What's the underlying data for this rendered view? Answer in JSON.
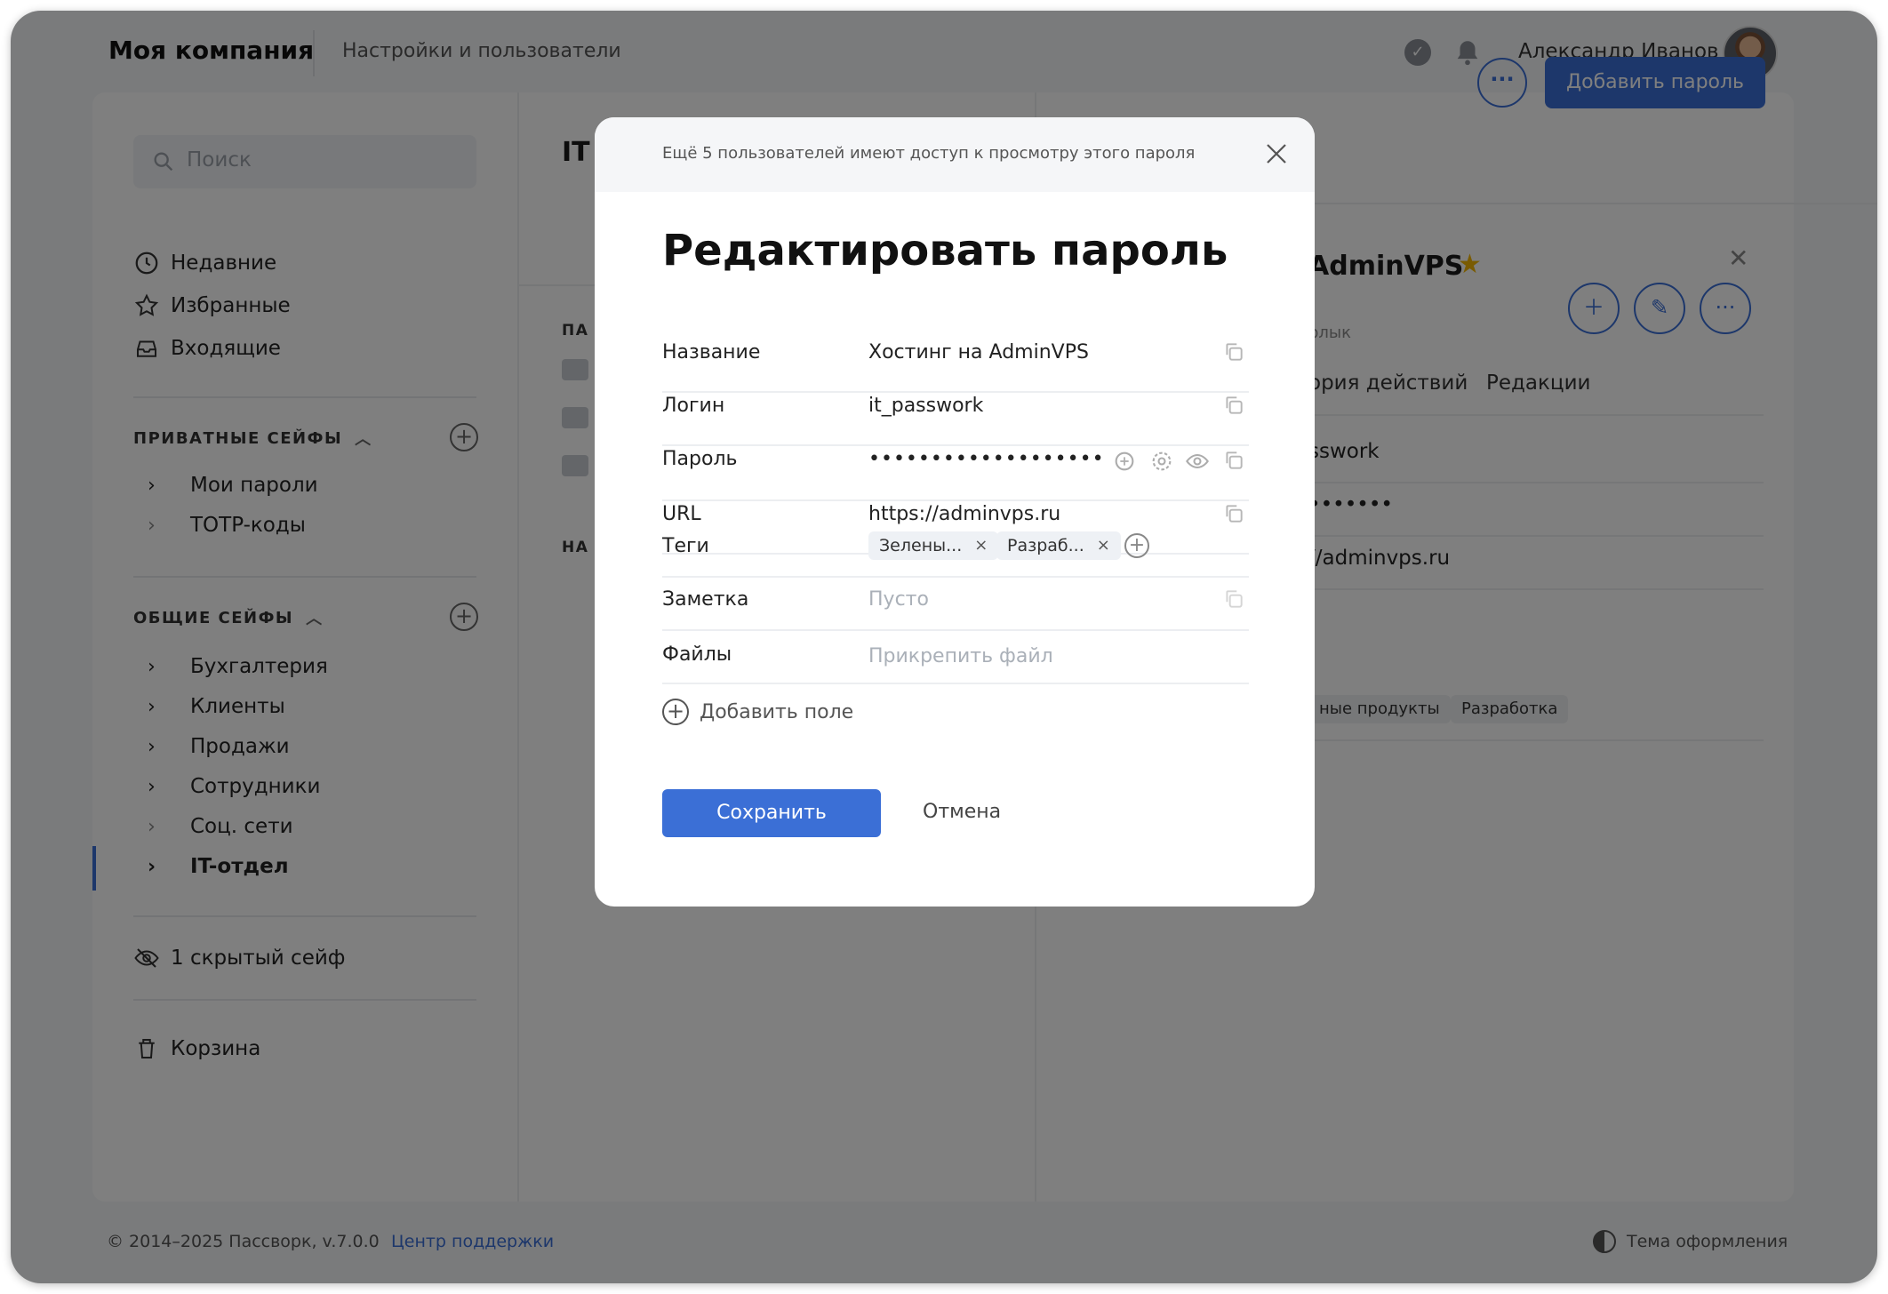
{
  "header": {
    "brand": "Моя компания",
    "subtitle": "Настройки и пользователи",
    "user_name": "Александр Иванов"
  },
  "sidebar": {
    "search_placeholder": "Поиск",
    "quick": [
      {
        "label": "Недавние",
        "icon": "clock-icon"
      },
      {
        "label": "Избранные",
        "icon": "star-icon"
      },
      {
        "label": "Входящие",
        "icon": "inbox-icon"
      }
    ],
    "private_title": "ПРИВАТНЫЕ СЕЙФЫ",
    "private_vaults": [
      "Мои пароли",
      "TOTP-коды"
    ],
    "shared_title": "ОБЩИЕ СЕЙФЫ",
    "shared_vaults": [
      "Бухгалтерия",
      "Клиенты",
      "Продажи",
      "Сотрудники",
      "Соц. сети",
      "IT-отдел"
    ],
    "hidden": "1 скрытый сейф",
    "trash": "Корзина"
  },
  "middle": {
    "title": "IT",
    "label1": "ПА",
    "label2": "НА"
  },
  "toolbar": {
    "more_label": "···",
    "add_password_label": "Добавить пароль"
  },
  "detail": {
    "title": "AdminVPS",
    "shortcut": "рлык",
    "tabs": [
      "ория действий",
      "Редакции"
    ],
    "login": "sswork",
    "password": "•••••••",
    "url": "//adminvps.ru",
    "tags": [
      "ные продукты",
      "Разработка"
    ]
  },
  "footer": {
    "copyright": "© 2014–2025 Пассворк, v.7.0.0",
    "support": "Центр поддержки",
    "theme": "Тема оформления"
  },
  "modal": {
    "banner": "Ещё 5 пользователей имеют доступ к просмотру этого пароля",
    "title": "Редактировать пароль",
    "fields": {
      "name_label": "Название",
      "name_value": "Хостинг на AdminVPS",
      "login_label": "Логин",
      "login_value": "it_passwork",
      "password_label": "Пароль",
      "password_value": "•••••••••••••••••••",
      "url_label": "URL",
      "url_value": "https://adminvps.ru",
      "tags_label": "Теги",
      "tags": [
        "Зелены...",
        "Разраб..."
      ],
      "note_label": "Заметка",
      "note_placeholder": "Пусто",
      "files_label": "Файлы",
      "files_placeholder": "Прикрепить файл"
    },
    "add_field": "Добавить поле",
    "save": "Сохранить",
    "cancel": "Отмена"
  },
  "colors": {
    "accent": "#3b6fd6",
    "star": "#f2b705"
  }
}
